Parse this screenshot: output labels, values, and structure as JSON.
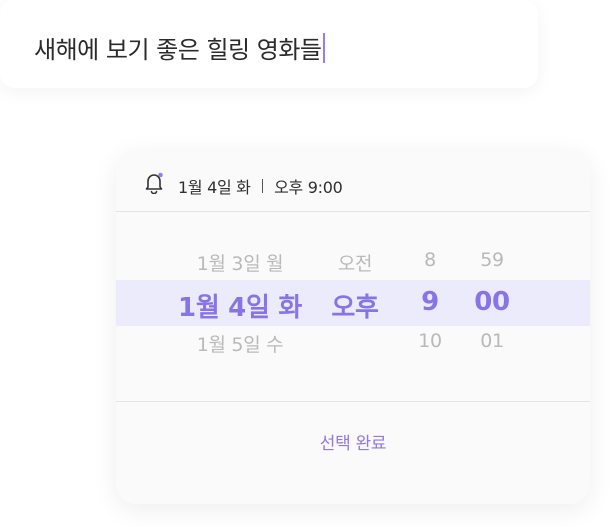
{
  "title_input": {
    "value": "새해에 보기 좋은 힐링 영화들"
  },
  "picker": {
    "header": {
      "date": "1월 4일 화",
      "time": "오후 9:00"
    },
    "columns": {
      "date": [
        "1월 3일 월",
        "1월 4일 화",
        "1월 5일 수"
      ],
      "period": [
        "오전",
        "오후",
        ""
      ],
      "hour": [
        "8",
        "9",
        "10"
      ],
      "minute": [
        "59",
        "00",
        "01"
      ]
    },
    "confirm_label": "선택 완료"
  },
  "colors": {
    "accent": "#8874e6",
    "caret": "#9b7be8",
    "highlight": "#ecebfb",
    "dim_text": "#b9b9b9"
  },
  "icons": {
    "header": "bell-icon"
  }
}
